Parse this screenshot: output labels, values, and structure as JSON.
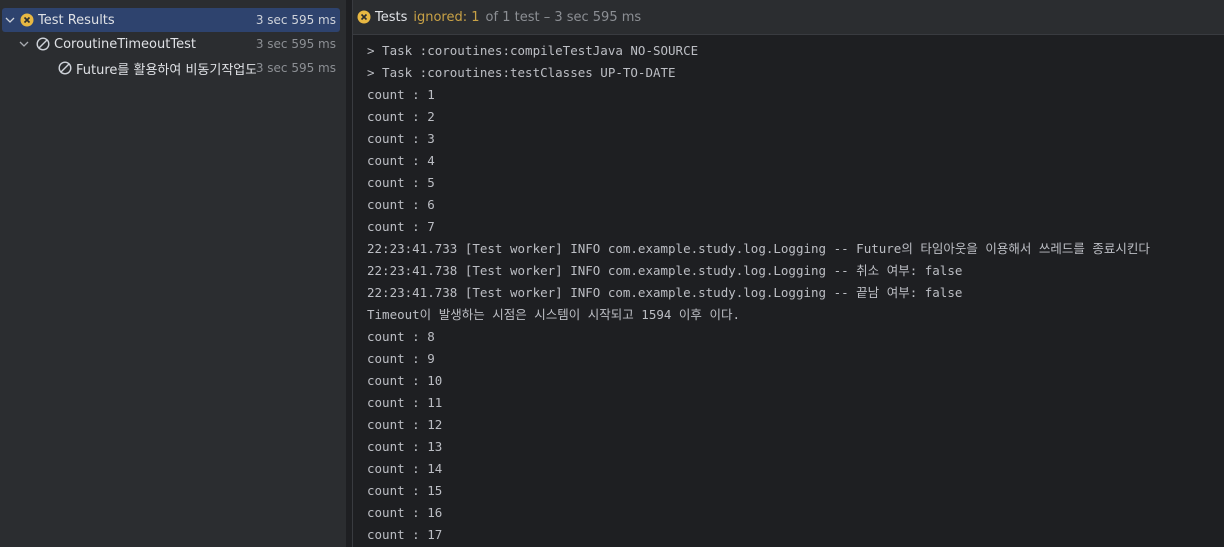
{
  "tree": {
    "items": [
      {
        "label": "Test Results",
        "time": "3 sec 595 ms",
        "icon": "ignored-warning-icon",
        "expanded": true,
        "selected": true
      },
      {
        "label": "CoroutineTimeoutTest",
        "time": "3 sec 595 ms",
        "icon": "ignored-icon",
        "expanded": true,
        "selected": false
      },
      {
        "label": "Future를 활용하여 비동기작업도",
        "time": "3 sec 595 ms",
        "icon": "ignored-icon",
        "expanded": false,
        "selected": false
      }
    ]
  },
  "status_bar": {
    "title": "Tests",
    "ignored": "ignored: 1",
    "rest": "of 1 test – 3 sec 595 ms"
  },
  "console": {
    "lines": [
      "> Task :coroutines:compileTestJava NO-SOURCE",
      "> Task :coroutines:testClasses UP-TO-DATE",
      "count : 1",
      "count : 2",
      "count : 3",
      "count : 4",
      "count : 5",
      "count : 6",
      "count : 7",
      "22:23:41.733 [Test worker] INFO com.example.study.log.Logging -- Future의 타임아웃을 이용해서 쓰레드를 종료시킨다",
      "22:23:41.738 [Test worker] INFO com.example.study.log.Logging -- 취소 여부: false",
      "22:23:41.738 [Test worker] INFO com.example.study.log.Logging -- 끝남 여부: false",
      "Timeout이 발생하는 시점은 시스템이 시작되고 1594 이후 이다.",
      "count : 8",
      "count : 9",
      "count : 10",
      "count : 11",
      "count : 12",
      "count : 13",
      "count : 14",
      "count : 15",
      "count : 16",
      "count : 17"
    ]
  },
  "colors": {
    "accent_selected": "#2e436e",
    "ignored_yellow": "#e8b842"
  }
}
